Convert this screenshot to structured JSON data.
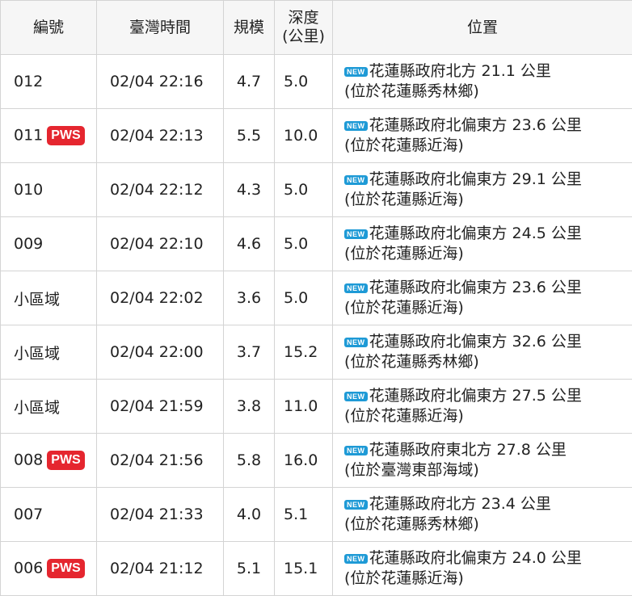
{
  "header": {
    "id": "編號",
    "time": "臺灣時間",
    "magnitude": "規模",
    "depth_line1": "深度",
    "depth_line2": "(公里)",
    "location": "位置"
  },
  "badges": {
    "pws": "PWS",
    "new": "NEW"
  },
  "colors": {
    "pws": "#e5262f",
    "new": "#1e9ad6",
    "header_bg": "#f6f6f6",
    "border": "#d4d4d4"
  },
  "rows": [
    {
      "id": "012",
      "pws": false,
      "time": "02/04 22:16",
      "mag": "4.7",
      "depth": "5.0",
      "loc1": "花蓮縣政府北方 21.1 公里",
      "loc2": "(位於花蓮縣秀林鄉)"
    },
    {
      "id": "011",
      "pws": true,
      "time": "02/04 22:13",
      "mag": "5.5",
      "depth": "10.0",
      "loc1": "花蓮縣政府北偏東方 23.6 公里",
      "loc2": "(位於花蓮縣近海)"
    },
    {
      "id": "010",
      "pws": false,
      "time": "02/04 22:12",
      "mag": "4.3",
      "depth": "5.0",
      "loc1": "花蓮縣政府北偏東方 29.1 公里",
      "loc2": "(位於花蓮縣近海)"
    },
    {
      "id": "009",
      "pws": false,
      "time": "02/04 22:10",
      "mag": "4.6",
      "depth": "5.0",
      "loc1": "花蓮縣政府北偏東方 24.5 公里",
      "loc2": "(位於花蓮縣近海)"
    },
    {
      "id": "小區域",
      "pws": false,
      "time": "02/04 22:02",
      "mag": "3.6",
      "depth": "5.0",
      "loc1": "花蓮縣政府北偏東方 23.6 公里",
      "loc2": "(位於花蓮縣近海)"
    },
    {
      "id": "小區域",
      "pws": false,
      "time": "02/04 22:00",
      "mag": "3.7",
      "depth": "15.2",
      "loc1": "花蓮縣政府北偏東方 32.6 公里",
      "loc2": "(位於花蓮縣秀林鄉)"
    },
    {
      "id": "小區域",
      "pws": false,
      "time": "02/04 21:59",
      "mag": "3.8",
      "depth": "11.0",
      "loc1": "花蓮縣政府北偏東方 27.5 公里",
      "loc2": "(位於花蓮縣近海)"
    },
    {
      "id": "008",
      "pws": true,
      "time": "02/04 21:56",
      "mag": "5.8",
      "depth": "16.0",
      "loc1": "花蓮縣政府東北方 27.8 公里",
      "loc2": "(位於臺灣東部海域)"
    },
    {
      "id": "007",
      "pws": false,
      "time": "02/04 21:33",
      "mag": "4.0",
      "depth": "5.1",
      "loc1": "花蓮縣政府北方 23.4 公里",
      "loc2": "(位於花蓮縣秀林鄉)"
    },
    {
      "id": "006",
      "pws": true,
      "time": "02/04 21:12",
      "mag": "5.1",
      "depth": "15.1",
      "loc1": "花蓮縣政府北偏東方 24.0 公里",
      "loc2": "(位於花蓮縣近海)"
    }
  ]
}
